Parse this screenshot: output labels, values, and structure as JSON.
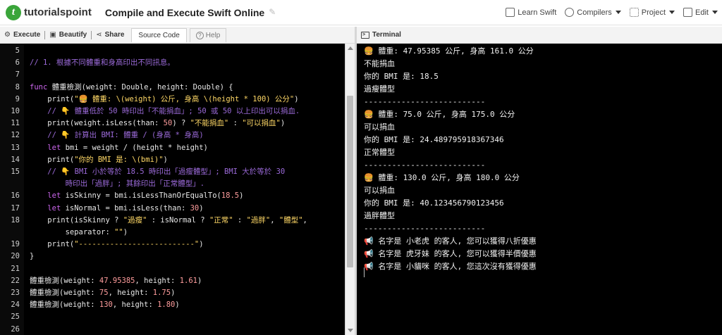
{
  "header": {
    "logo_text": "tutorialspoint",
    "page_title": "Compile and Execute Swift Online",
    "menu": [
      {
        "label": "Learn Swift",
        "icon": "book-icon"
      },
      {
        "label": "Compilers",
        "icon": "code-icon",
        "dropdown": true
      },
      {
        "label": "Project",
        "icon": "grid-icon",
        "dropdown": true
      },
      {
        "label": "Edit",
        "icon": "edit-icon",
        "dropdown": true
      }
    ]
  },
  "left_toolbar": {
    "execute": "Execute",
    "beautify": "Beautify",
    "share": "Share",
    "source_code": "Source Code",
    "help": "Help"
  },
  "right_toolbar": {
    "terminal": "Terminal"
  },
  "editor": {
    "lines": [
      {
        "n": "5",
        "segs": []
      },
      {
        "n": "6",
        "segs": [
          {
            "t": "// 1. 根據不同體重和身高印出不同訊息。",
            "c": "cm"
          }
        ]
      },
      {
        "n": "7",
        "segs": []
      },
      {
        "n": "8",
        "segs": [
          {
            "t": "func",
            "c": "kw"
          },
          {
            "t": " 體重檢測(weight: Double, height: Double) {",
            "c": "pl"
          }
        ]
      },
      {
        "n": "9",
        "segs": [
          {
            "t": "    print(",
            "c": "pl"
          },
          {
            "t": "\"🍔 體重: \\(weight) 公斤, 身高 \\(height * 100) 公分\"",
            "c": "st"
          },
          {
            "t": ")",
            "c": "pl"
          }
        ]
      },
      {
        "n": "10",
        "segs": [
          {
            "t": "    // 👇 體重低於 50 時印出「不能捐血」; 50 或 50 以上印出可以捐血.",
            "c": "cm"
          }
        ]
      },
      {
        "n": "11",
        "segs": [
          {
            "t": "    print(weight.isLess(than: ",
            "c": "pl"
          },
          {
            "t": "50",
            "c": "nm"
          },
          {
            "t": ") ? ",
            "c": "pl"
          },
          {
            "t": "\"不能捐血\"",
            "c": "st"
          },
          {
            "t": " : ",
            "c": "pl"
          },
          {
            "t": "\"可以捐血\"",
            "c": "st"
          },
          {
            "t": ")",
            "c": "pl"
          }
        ]
      },
      {
        "n": "12",
        "segs": [
          {
            "t": "    // 👇 計算出 BMI: 體重 / (身高 * 身高)",
            "c": "cm"
          }
        ]
      },
      {
        "n": "13",
        "segs": [
          {
            "t": "    ",
            "c": "pl"
          },
          {
            "t": "let",
            "c": "kw"
          },
          {
            "t": " bmi = weight / (height * height)",
            "c": "pl"
          }
        ]
      },
      {
        "n": "14",
        "segs": [
          {
            "t": "    print(",
            "c": "pl"
          },
          {
            "t": "\"你的 BMI 是: \\(bmi)\"",
            "c": "st"
          },
          {
            "t": ")",
            "c": "pl"
          }
        ]
      },
      {
        "n": "15",
        "segs": [
          {
            "t": "    // 👇 BMI 小於等於 18.5 時印出「過瘦體型」; BMI 大於等於 30",
            "c": "cm"
          }
        ]
      },
      {
        "n": "",
        "segs": [
          {
            "t": "        時印出「過胖」; 其餘印出「正常體型」.",
            "c": "cm"
          }
        ]
      },
      {
        "n": "16",
        "segs": [
          {
            "t": "    ",
            "c": "pl"
          },
          {
            "t": "let",
            "c": "kw"
          },
          {
            "t": " isSkinny = bmi.isLessThanOrEqualTo(",
            "c": "pl"
          },
          {
            "t": "18.5",
            "c": "nm"
          },
          {
            "t": ")",
            "c": "pl"
          }
        ]
      },
      {
        "n": "17",
        "segs": [
          {
            "t": "    ",
            "c": "pl"
          },
          {
            "t": "let",
            "c": "kw"
          },
          {
            "t": " isNormal = bmi.isLess(than: ",
            "c": "pl"
          },
          {
            "t": "30",
            "c": "nm"
          },
          {
            "t": ")",
            "c": "pl"
          }
        ]
      },
      {
        "n": "18",
        "segs": [
          {
            "t": "    print(isSkinny ? ",
            "c": "pl"
          },
          {
            "t": "\"過瘦\"",
            "c": "st"
          },
          {
            "t": " : isNormal ? ",
            "c": "pl"
          },
          {
            "t": "\"正常\"",
            "c": "st"
          },
          {
            "t": " : ",
            "c": "pl"
          },
          {
            "t": "\"過胖\"",
            "c": "st"
          },
          {
            "t": ", ",
            "c": "pl"
          },
          {
            "t": "\"體型\"",
            "c": "st"
          },
          {
            "t": ",",
            "c": "pl"
          }
        ]
      },
      {
        "n": "",
        "segs": [
          {
            "t": "        separator: ",
            "c": "pl"
          },
          {
            "t": "\"\"",
            "c": "st"
          },
          {
            "t": ")",
            "c": "pl"
          }
        ]
      },
      {
        "n": "19",
        "segs": [
          {
            "t": "    print(",
            "c": "pl"
          },
          {
            "t": "\"--------------------------\"",
            "c": "st"
          },
          {
            "t": ")",
            "c": "pl"
          }
        ]
      },
      {
        "n": "20",
        "segs": [
          {
            "t": "}",
            "c": "pl"
          }
        ]
      },
      {
        "n": "21",
        "segs": []
      },
      {
        "n": "22",
        "segs": [
          {
            "t": "體重檢測(weight: ",
            "c": "pl"
          },
          {
            "t": "47.95385",
            "c": "nm"
          },
          {
            "t": ", height: ",
            "c": "pl"
          },
          {
            "t": "1.61",
            "c": "nm"
          },
          {
            "t": ")",
            "c": "pl"
          }
        ]
      },
      {
        "n": "23",
        "segs": [
          {
            "t": "體重檢測(weight: ",
            "c": "pl"
          },
          {
            "t": "75",
            "c": "nm"
          },
          {
            "t": ", height: ",
            "c": "pl"
          },
          {
            "t": "1.75",
            "c": "nm"
          },
          {
            "t": ")",
            "c": "pl"
          }
        ]
      },
      {
        "n": "24",
        "segs": [
          {
            "t": "體重檢測(weight: ",
            "c": "pl"
          },
          {
            "t": "130",
            "c": "nm"
          },
          {
            "t": ", height: ",
            "c": "pl"
          },
          {
            "t": "1.80",
            "c": "nm"
          },
          {
            "t": ")",
            "c": "pl"
          }
        ]
      },
      {
        "n": "25",
        "segs": []
      },
      {
        "n": "26",
        "segs": []
      }
    ]
  },
  "terminal": {
    "lines": [
      "🍔 體重: 47.95385 公斤, 身高 161.0 公分",
      "不能捐血",
      "你的 BMI 是: 18.5",
      "過瘦體型",
      "--------------------------",
      "🍔 體重: 75.0 公斤, 身高 175.0 公分",
      "可以捐血",
      "你的 BMI 是: 24.489795918367346",
      "正常體型",
      "--------------------------",
      "🍔 體重: 130.0 公斤, 身高 180.0 公分",
      "可以捐血",
      "你的 BMI 是: 40.123456790123456",
      "過胖體型",
      "--------------------------",
      "📢 名字是 小老虎 的客人, 您可以獲得八折優惠",
      "📢 名字是 虎牙妹 的客人, 您可以獲得半價優惠",
      "📢 名字是 小貓咪 的客人, 您這次沒有獲得優惠"
    ]
  }
}
